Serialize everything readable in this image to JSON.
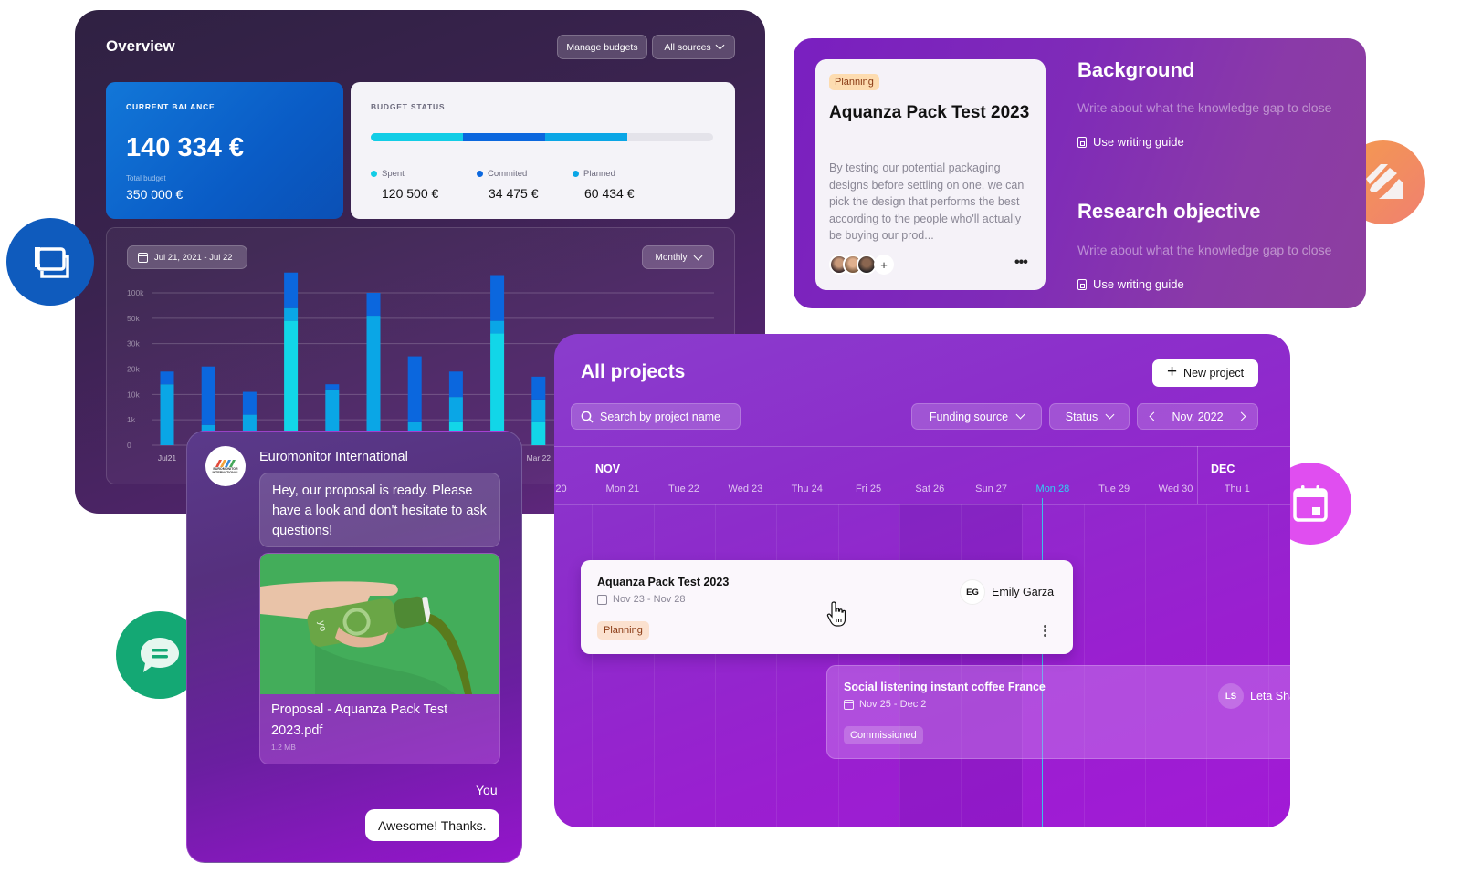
{
  "overview": {
    "title": "Overview",
    "manage_budgets": "Manage budgets",
    "all_sources": "All sources",
    "current_balance": {
      "label": "CURRENT BALANCE",
      "value": "140 334 €",
      "total_label": "Total budget",
      "total_value": "350 000 €"
    },
    "budget_status": {
      "label": "BUDGET STATUS",
      "progress": {
        "spent_pct": 27,
        "committed_pct": 24,
        "planned_pct": 24
      },
      "items": [
        {
          "label": "Spent",
          "value": "120 500 €",
          "color": "#12cde6"
        },
        {
          "label": "Commited",
          "value": "34 475 €",
          "color": "#0b67de"
        },
        {
          "label": "Planned",
          "value": "60 434 €",
          "color": "#0aa6e6"
        }
      ]
    },
    "date_range": "Jul 21, 2021 - Jul 22",
    "interval": "Monthly"
  },
  "chart_data": {
    "type": "bar",
    "stacked": true,
    "title": "",
    "xlabel": "",
    "ylabel": "",
    "ytick_labels": [
      "0",
      "1k",
      "10k",
      "20k",
      "30k",
      "50k",
      "100k"
    ],
    "categories": [
      "Jul21",
      "",
      "",
      "",
      "",
      "",
      "",
      "",
      "",
      "Mar 22"
    ],
    "x_tick_labels_visible": [
      "Jul21",
      "Mar 22"
    ],
    "grid": true,
    "legend": "none",
    "series": [
      {
        "name": "Spent",
        "color": "#12d6e8",
        "values_tick_units": [
          0,
          0.4,
          0.3,
          4.9,
          0,
          0.3,
          0.2,
          0.9,
          4.4,
          0.9
        ]
      },
      {
        "name": "Planned",
        "color": "#0aa6e6",
        "values_tick_units": [
          2.4,
          0.4,
          0.9,
          0.5,
          2.2,
          4.8,
          0.7,
          1.0,
          0.5,
          0.9
        ]
      },
      {
        "name": "Commited",
        "color": "#0b67de",
        "values_tick_units": [
          0.5,
          2.3,
          0.9,
          1.4,
          0.2,
          0.9,
          2.6,
          1.0,
          1.8,
          0.9
        ]
      }
    ],
    "note": "values in tick units on the non-linear axis: 0=0,1=1k,2=10k,3=20k,4=30k,5=50k,6=100k"
  },
  "doc": {
    "badge": "Planning",
    "title": "Aquanza Pack Test 2023",
    "description": "By testing our potential packaging designs before settling on one, we can pick the design that performs the best according to the people who'll actually be buying our prod...",
    "more": "•••",
    "plus": "+",
    "sections": [
      {
        "title": "Background",
        "hint": "Write about what the knowledge gap to close",
        "link": "Use writing guide"
      },
      {
        "title": "Research objective",
        "hint": "Write about what the knowledge gap to close",
        "link": "Use writing guide"
      }
    ]
  },
  "chat": {
    "sender": "Euromonitor International",
    "logo_text": "EUROMONITOR INTERNATIONAL",
    "message": "Hey, our proposal is ready. Please have a look and don't hesitate to ask questions!",
    "attachment": {
      "name": "Proposal - Aquanza Pack Test 2023.pdf",
      "size": "1.2 MB"
    },
    "you_label": "You",
    "reply": "Awesome! Thanks."
  },
  "projects": {
    "title": "All projects",
    "new_project": "New project",
    "search_placeholder": "Search by project name",
    "funding_source": "Funding source",
    "status": "Status",
    "month": "Nov, 2022",
    "months": [
      "NOV",
      "DEC"
    ],
    "days": [
      "20",
      "Mon 21",
      "Tue 22",
      "Wed 23",
      "Thu 24",
      "Fri 25",
      "Sat 26",
      "Sun 27",
      "Mon 28",
      "Tue 29",
      "Wed 30",
      "Thu 1"
    ],
    "today": "Mon 28",
    "today_color": "#2fd2f4",
    "tasks": [
      {
        "title": "Aquanza Pack Test 2023",
        "dates": "Nov 23 - Nov 28",
        "status": "Planning",
        "owner_initials": "EG",
        "owner": "Emily Garza"
      },
      {
        "title": "Social listening instant coffee France",
        "dates": "Nov 25 - Dec 2",
        "status": "Commissioned",
        "owner_initials": "LS",
        "owner": "Leta Shaw"
      }
    ]
  }
}
